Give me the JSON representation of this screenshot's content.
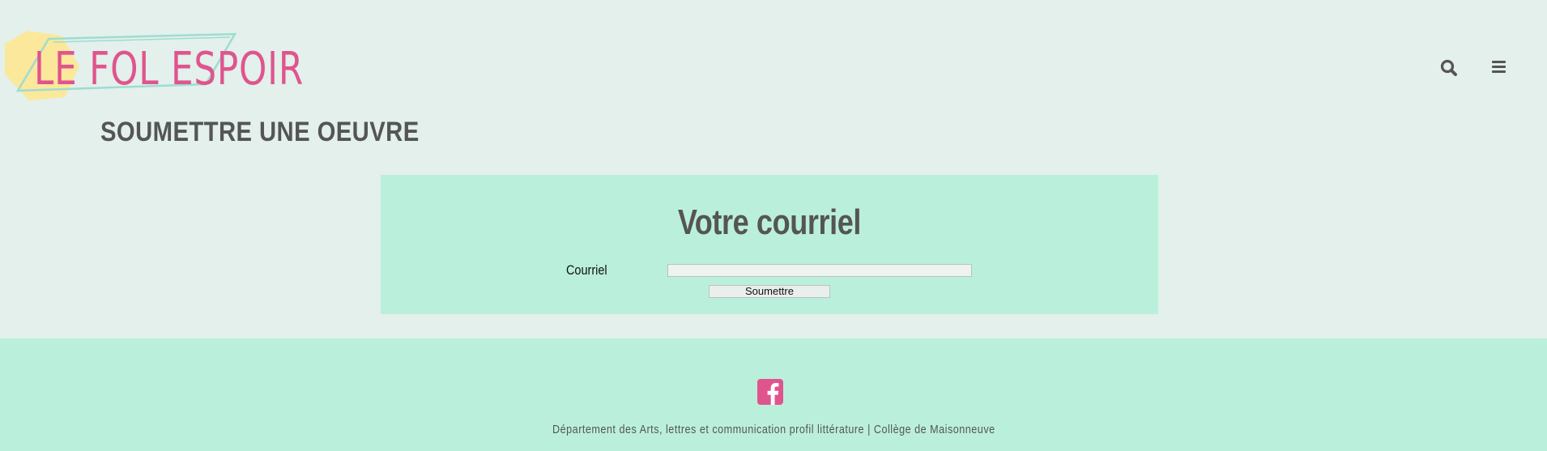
{
  "header": {
    "logo_text": "LE FOL ESPOIR",
    "page_title": "SOUMETTRE UNE OEUVRE",
    "search_icon": "search-icon",
    "menu_icon": "hamburger-menu-icon"
  },
  "form": {
    "heading": "Votre courriel",
    "email_label": "Courriel",
    "email_value": "",
    "email_placeholder": "",
    "submit_label": "Soumettre"
  },
  "footer": {
    "social_icon": "facebook-icon",
    "credit_text": "Département des Arts, lettres et communication profil littérature | Collège de Maisonneuve"
  },
  "colors": {
    "background": "#e3f0eb",
    "panel": "#baf0db",
    "brand_pink": "#e0548e",
    "hexagon_yellow": "#fbe89a",
    "logo_outline_teal": "#9fdcd0",
    "text_gray": "#555555"
  }
}
